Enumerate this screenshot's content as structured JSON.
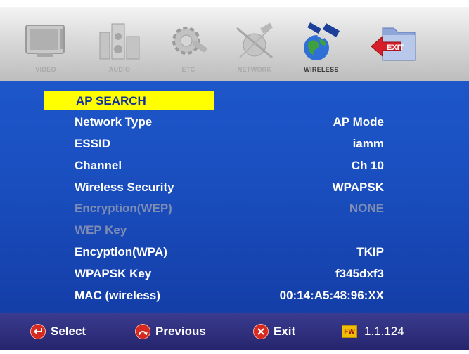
{
  "menu": {
    "items": [
      {
        "label": "VIDEO",
        "icon": "tv-icon"
      },
      {
        "label": "AUDIO",
        "icon": "speaker-icon"
      },
      {
        "label": "ETC",
        "icon": "gear-icon"
      },
      {
        "label": "NETWORK",
        "icon": "satellite-network-icon"
      },
      {
        "label": "WIRELESS",
        "icon": "satellite-earth-icon"
      },
      {
        "label": "",
        "icon": "exit-folder-icon",
        "badge": "EXIT"
      }
    ],
    "active": "WIRELESS"
  },
  "settings": {
    "rows": [
      {
        "label": "AP SEARCH",
        "value": "",
        "state": "selected"
      },
      {
        "label": "Network Type",
        "value": "AP Mode",
        "state": "normal"
      },
      {
        "label": "ESSID",
        "value": "iamm",
        "state": "normal"
      },
      {
        "label": "Channel",
        "value": "Ch 10",
        "state": "normal"
      },
      {
        "label": "Wireless Security",
        "value": "WPAPSK",
        "state": "normal"
      },
      {
        "label": "Encryption(WEP)",
        "value": "NONE",
        "state": "disabled"
      },
      {
        "label": "WEP Key",
        "value": "",
        "state": "disabled"
      },
      {
        "label": "Encyption(WPA)",
        "value": "TKIP",
        "state": "normal"
      },
      {
        "label": "WPAPSK Key",
        "value": "f345dxf3",
        "state": "normal"
      },
      {
        "label": "MAC (wireless)",
        "value": "00:14:A5:48:96:XX",
        "state": "normal"
      }
    ]
  },
  "bottom": {
    "select_label": "Select",
    "previous_label": "Previous",
    "exit_label": "Exit",
    "fw_badge": "FW",
    "fw_version": "1.1.124"
  },
  "colors": {
    "panel_blue": "#1a4fc0",
    "highlight_yellow": "#ffff00",
    "bottom_bar": "#2a2a78",
    "disabled_text": "#7f8db4"
  }
}
